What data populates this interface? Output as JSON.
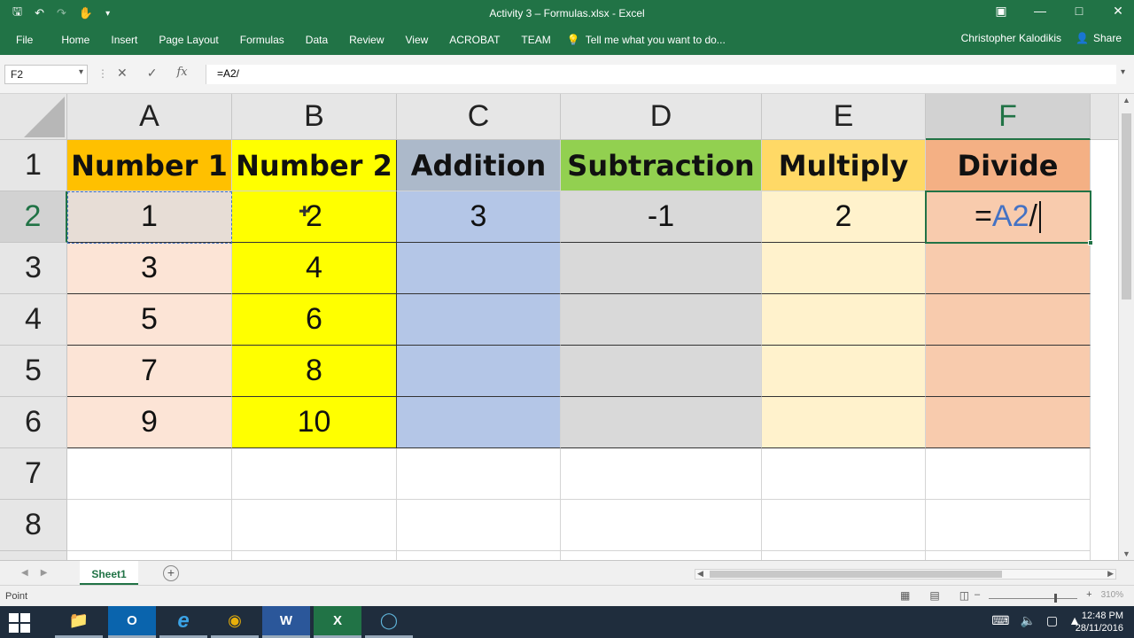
{
  "window": {
    "title": "Activity 3 – Formulas.xlsx - Excel",
    "controls": [
      "restore-ribbon",
      "minimize",
      "maximize",
      "close"
    ]
  },
  "qat": {
    "save_icon": "save-icon",
    "undo_icon": "undo-icon",
    "redo_icon": "redo-icon",
    "touch_icon": "touch-mode-icon",
    "customize_icon": "customize-qat-icon"
  },
  "ribbon": {
    "file": "File",
    "tabs": [
      "Home",
      "Insert",
      "Page Layout",
      "Formulas",
      "Data",
      "Review",
      "View",
      "ACROBAT",
      "TEAM"
    ],
    "tellme": "Tell me what you want to do...",
    "user": "Christopher Kalodikis",
    "share": "Share"
  },
  "formula_bar": {
    "name_box": "F2",
    "formula": "=A2/"
  },
  "columns": [
    "A",
    "B",
    "C",
    "D",
    "E",
    "F"
  ],
  "rows": [
    "1",
    "2",
    "3",
    "4",
    "5",
    "6",
    "7",
    "8"
  ],
  "cells": {
    "header": [
      "Number 1",
      "Number 2",
      "Addition",
      "Subtraction",
      "Multiply",
      "Divide"
    ],
    "number1": [
      "1",
      "3",
      "5",
      "7",
      "9"
    ],
    "number2": [
      "2",
      "4",
      "6",
      "8",
      "10"
    ],
    "row2": {
      "addition": "3",
      "subtraction": "-1",
      "multiply": "2",
      "divide_eq": "=",
      "divide_ref": "A2",
      "divide_op": "/"
    }
  },
  "colors": {
    "excel_green": "#217346",
    "number1_header": "#ffc000",
    "number1_fill": "#fce4d6",
    "number2_fill": "#ffff00",
    "addition_header": "#acb9ca",
    "addition_fill": "#b4c6e7",
    "subtraction_header": "#92d050",
    "subtraction_fill": "#d9d9d9",
    "multiply_header": "#ffd966",
    "multiply_fill": "#fff2cc",
    "divide_header": "#f4b084",
    "divide_fill": "#f8cbad"
  },
  "sheets": {
    "tabs": [
      "Sheet1"
    ]
  },
  "status": {
    "mode": "Point",
    "zoom": "310%"
  },
  "taskbar": {
    "apps": [
      "file-explorer-icon",
      "outlook-icon",
      "internet-explorer-icon",
      "chrome-icon",
      "word-icon",
      "excel-icon",
      "cortana-icon"
    ],
    "time": "12:48 PM",
    "date": "28/11/2016"
  }
}
